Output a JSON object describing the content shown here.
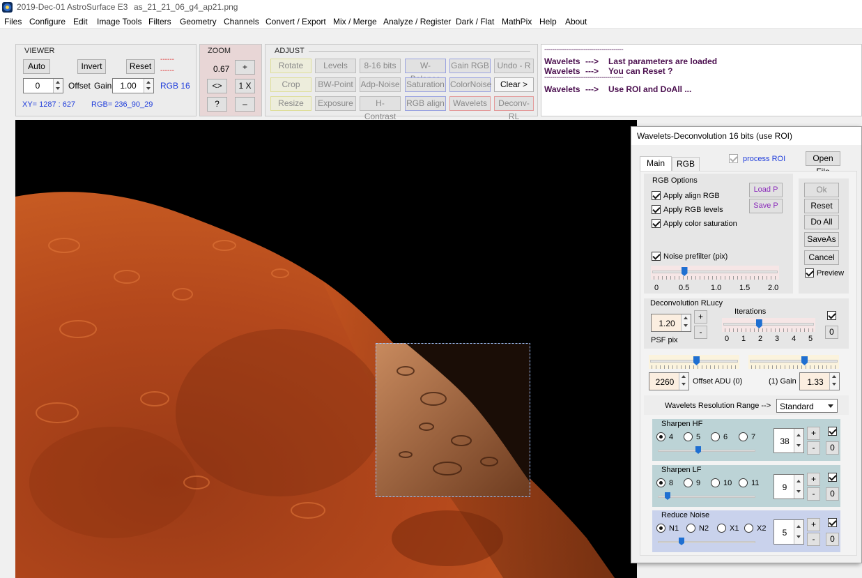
{
  "window": {
    "title_date": "2019-Dec-01",
    "app_name": "AstroSurface E3",
    "file_name": "as_21_21_06_g4_ap21.png"
  },
  "menu": [
    "Files",
    "Configure",
    "Edit",
    "Image Tools",
    "Filters",
    "Geometry",
    "Channels",
    "Convert / Export",
    "Mix / Merge",
    "Analyze / Register",
    "Dark / Flat",
    "MathPix",
    "Help",
    "About"
  ],
  "viewer": {
    "label": "VIEWER",
    "auto": "Auto",
    "invert": "Invert",
    "reset": "Reset",
    "red_dash_1": "------",
    "red_dash_2": "------",
    "offset_value": "0",
    "offset_label": "Offset",
    "gain_label": "Gain",
    "gain_value": "1.00",
    "rgb_depth": "RGB 16",
    "xy_readout": "XY=  1287 : 627",
    "rgb_readout": "RGB=  236_90_29"
  },
  "zoom": {
    "label": "ZOOM",
    "value": "0.67",
    "plus": "+",
    "fit": "<>",
    "onex": "1 X",
    "help": "?",
    "minus": "–"
  },
  "adjust": {
    "label": "ADJUST",
    "row1": [
      "Rotate",
      "Levels",
      "8-16 bits",
      "W-Balance",
      "Gain RGB",
      "Undo - R"
    ],
    "row2": [
      "Crop",
      "BW-Point",
      "Adp-Noise",
      "Saturation",
      "ColorNoise",
      "Clear >"
    ],
    "row3": [
      "Resize",
      "Exposure",
      "H-Contrast",
      "RGB align",
      "Wavelets",
      "Deconv-RL"
    ]
  },
  "messages": {
    "dashes": "----------------------------------------",
    "line1_a": "Wavelets",
    "line1_b": "--->",
    "line1_c": "Last parameters are loaded",
    "line2_a": "Wavelets",
    "line2_b": "--->",
    "line2_c": "You can Reset ?",
    "line3_a": "Wavelets",
    "line3_b": "--->",
    "line3_c": "Use ROI and DoAll ..."
  },
  "wavelets_panel": {
    "title": "Wavelets-Deconvolution 16 bits (use ROI)",
    "tab_main": "Main",
    "tab_rgb": "RGB",
    "process_roi": "process ROI",
    "open_file": "Open File",
    "rgb_options": "RGB Options",
    "apply_align": "Apply align RGB",
    "apply_levels": "Apply RGB levels",
    "apply_saturation": "Apply color saturation",
    "load_p": "Load P",
    "save_p": "Save P",
    "ok": "Ok",
    "reset": "Reset",
    "do_all": "Do All",
    "save_as": "SaveAs",
    "cancel": "Cancel",
    "preview": "Preview",
    "noise_prefilter": "Noise prefilter (pix)",
    "noise_scale": [
      "0",
      "0.5",
      "1.0",
      "1.5",
      "2.0"
    ],
    "noise_value": 0.5,
    "deconv_label": "Deconvolution RLucy",
    "iterations_label": "Iterations",
    "psf_value": "1.20",
    "psf_label": "PSF pix",
    "plus": "+",
    "minus": "-",
    "zero": "0",
    "iter_scale": [
      "0",
      "1",
      "2",
      "3",
      "4",
      "5"
    ],
    "iterations_value": 2,
    "offset_value": "2260",
    "offset_label": "Offset ADU (0)",
    "gain_label": "(1)  Gain",
    "gain_value": "1.33",
    "res_range_label": "Wavelets Resolution Range  -->",
    "res_range_value": "Standard",
    "sharpen_hf": {
      "label": "Sharpen HF",
      "options": [
        "4",
        "5",
        "6",
        "7"
      ],
      "value": "38"
    },
    "sharpen_lf": {
      "label": "Sharpen LF",
      "options": [
        "8",
        "9",
        "10",
        "11"
      ],
      "value": "9"
    },
    "reduce_noise": {
      "label": "Reduce Noise",
      "options": [
        "N1",
        "N2",
        "X1",
        "X2"
      ],
      "value": "5"
    }
  }
}
